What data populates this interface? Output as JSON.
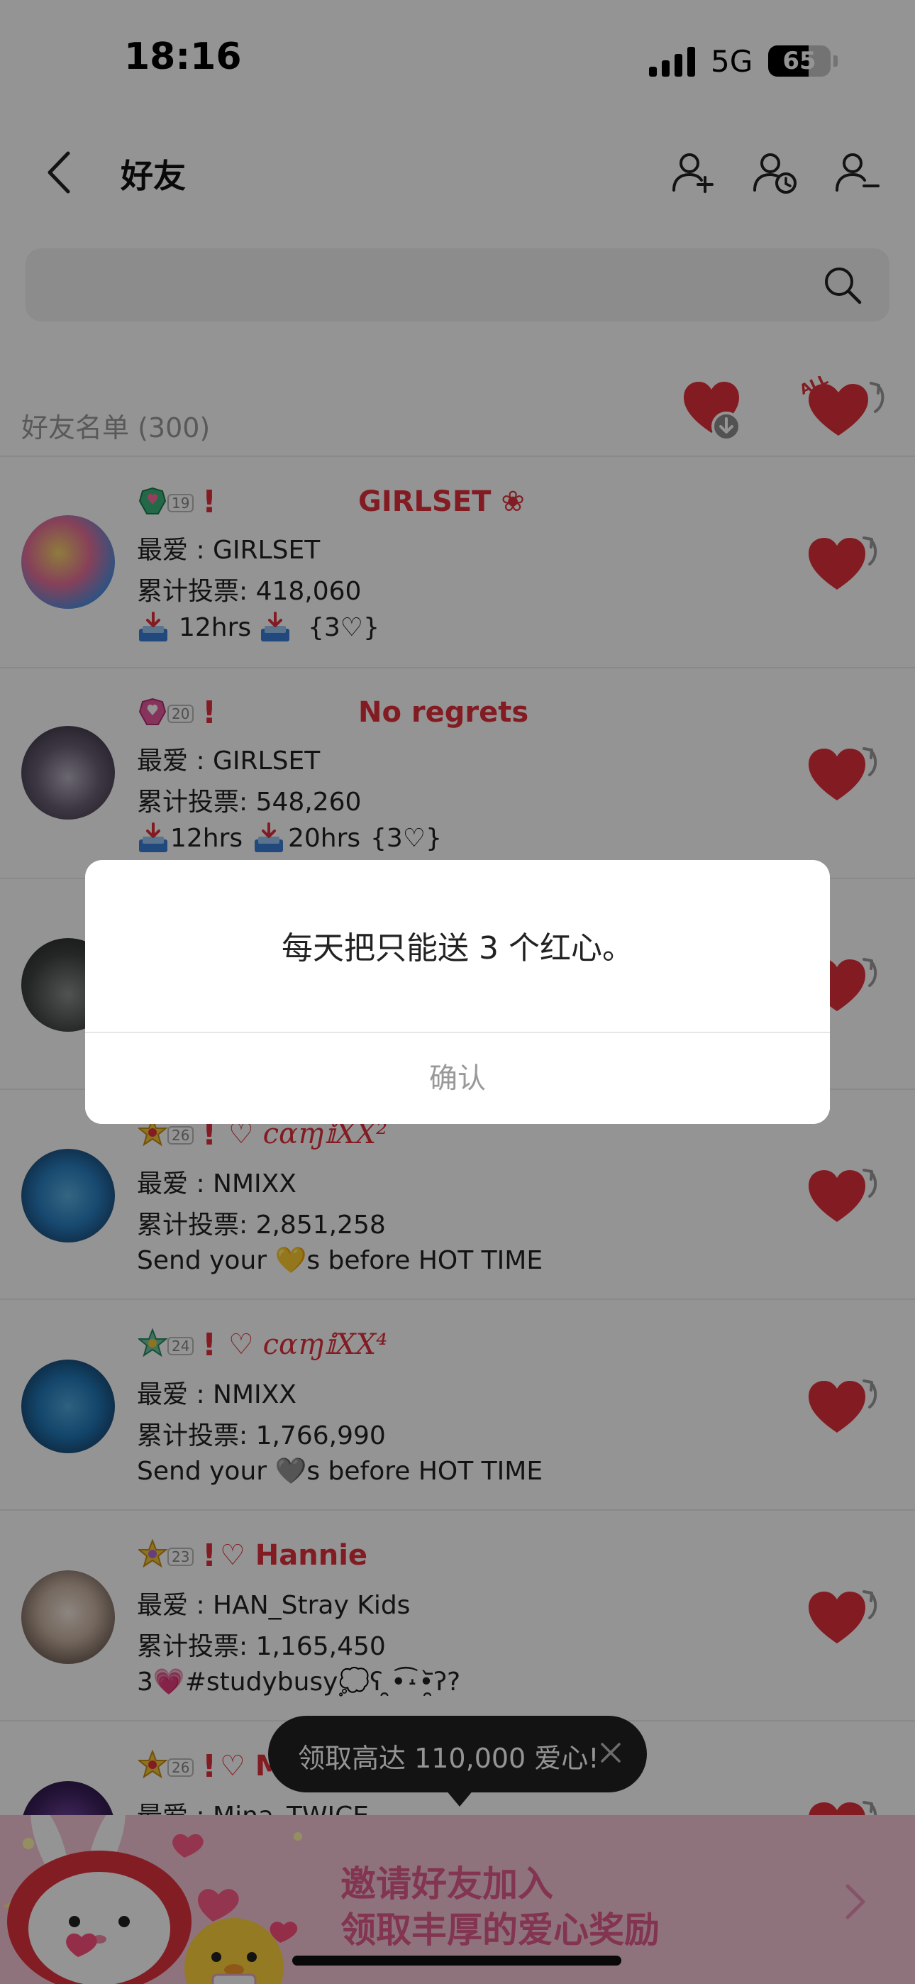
{
  "status_bar": {
    "time": "18:16",
    "network": "5G",
    "battery": "65",
    "battery_level": 0.65
  },
  "nav": {
    "title": "好友",
    "icons": [
      "back-icon",
      "add-friend-icon",
      "friend-history-icon",
      "remove-friend-icon"
    ]
  },
  "search": {
    "placeholder": "",
    "value": ""
  },
  "list_header": {
    "label": "好友名单 (300)",
    "icons": [
      "receive-all-hearts-icon",
      "send-all-hearts-icon"
    ]
  },
  "friends": [
    {
      "level": "19",
      "excl": "!",
      "nickname": "GIRLSET ❀",
      "favorite": "最爱 : GIRLSET",
      "votes": "累计投票: 418,060",
      "status": {
        "t1": "12hrs",
        "t2": "",
        "tail": "{3♡}"
      }
    },
    {
      "level": "20",
      "excl": "!",
      "nickname": "No regrets",
      "favorite": "最爱 : GIRLSET",
      "votes": "累计投票: 548,260",
      "status": {
        "t1": "12hrs",
        "t2": "20hrs",
        "tail": "{3♡}"
      }
    },
    {
      "level": "",
      "excl": "",
      "nickname": "",
      "favorite": "",
      "votes": "",
      "status": ""
    },
    {
      "level": "26",
      "excl": "!",
      "nickname": "♡ cɑɱ𝕚XX²",
      "favorite": "最爱 : NMIXX",
      "votes": "累计投票: 2,851,258",
      "status": {
        "pre": "Send your",
        "emoji": "💛",
        "post": "s before HOT TIME"
      }
    },
    {
      "level": "24",
      "excl": "!",
      "nickname": "♡ cɑɱ𝕚XX⁴",
      "favorite": "最爱 : NMIXX",
      "votes": "累计投票: 1,766,990",
      "status": {
        "pre": "Send your",
        "emoji": "🩶",
        "post": "s before HOT TIME"
      }
    },
    {
      "level": "23",
      "excl": "!",
      "nickname": "♡ Hannie",
      "favorite": "最爱 : HAN_Stray Kids",
      "votes": "累计投票: 1,165,450",
      "status": {
        "pre": "3",
        "emoji": "💗",
        "post": "#studybusy💭ʕ ̯•͡˔•̯᷅ʔ?"
      }
    },
    {
      "level": "26",
      "excl": "!",
      "nickname": "♡ M",
      "favorite": "最爱 : Mina_TWICE",
      "votes": "",
      "status": ""
    }
  ],
  "tooltip": {
    "text": "领取高达 110,000 爱心!"
  },
  "promo": {
    "line1": "邀请好友加入",
    "line2": "领取丰厚的爱心奖励"
  },
  "dialog": {
    "message": "每天把只能送 3 个红心。",
    "confirm": "确认"
  },
  "colors": {
    "accent_red": "#e0313b",
    "promo_pink": "#e05a8a",
    "overlay": "rgba(0,0,0,0.42)"
  }
}
